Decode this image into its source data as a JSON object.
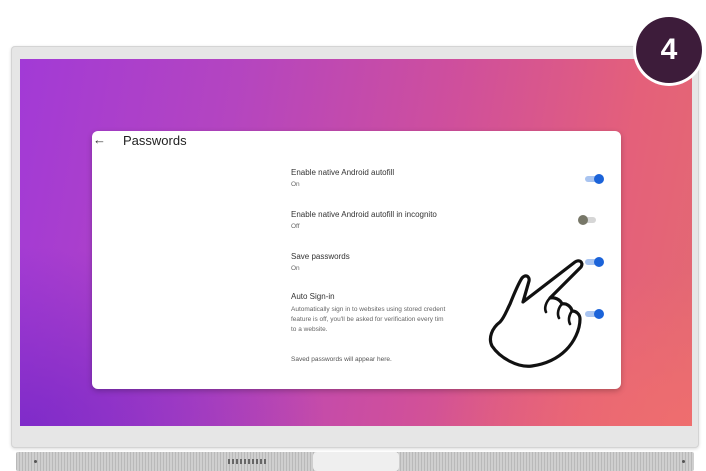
{
  "badge": {
    "step": "4"
  },
  "page": {
    "title": "Passwords"
  },
  "settings": [
    {
      "title": "Enable native Android autofill",
      "status": "On",
      "enabled": true
    },
    {
      "title": "Enable native Android autofill in incognito",
      "status": "Off",
      "enabled": false
    },
    {
      "title": "Save passwords",
      "status": "On",
      "enabled": true
    },
    {
      "title": "Auto Sign-in",
      "description": [
        "Automatically sign in to websites using stored credent",
        "feature is off, you'll be asked for verification every tim",
        "to a website."
      ],
      "enabled": true
    }
  ],
  "empty_message": "Saved passwords will appear here.",
  "icons": {
    "back": "arrow-left-icon",
    "hand": "pointing-hand-icon"
  },
  "colors": {
    "toggle_on": "#1b63d9",
    "toggle_off": "#777768",
    "badge": "#3d1c3a"
  }
}
